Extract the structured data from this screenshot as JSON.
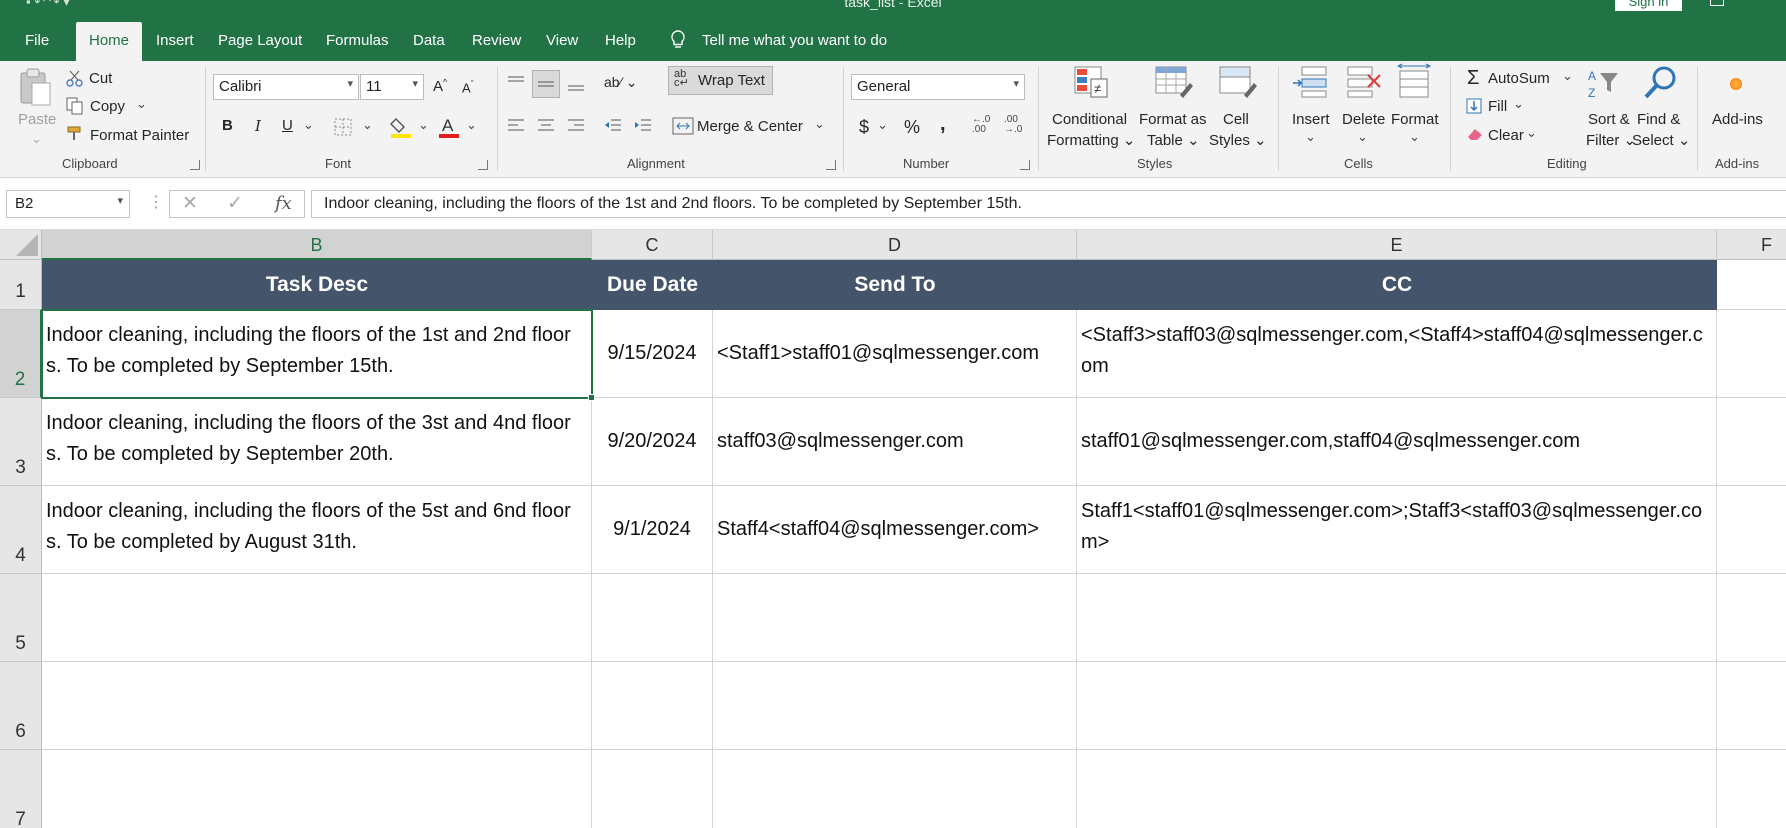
{
  "window": {
    "title": "task_list  -  Excel",
    "signin": "Sign in"
  },
  "tabs": [
    {
      "label": "File"
    },
    {
      "label": "Home"
    },
    {
      "label": "Insert"
    },
    {
      "label": "Page Layout"
    },
    {
      "label": "Formulas"
    },
    {
      "label": "Data"
    },
    {
      "label": "Review"
    },
    {
      "label": "View"
    },
    {
      "label": "Help"
    }
  ],
  "tell_me": "Tell me what you want to do",
  "ribbon": {
    "clipboard": {
      "paste": "Paste",
      "cut": "Cut",
      "copy": "Copy",
      "format_painter": "Format Painter",
      "group": "Clipboard"
    },
    "font": {
      "name": "Calibri",
      "size": "11",
      "group": "Font",
      "bold": "B",
      "italic": "I",
      "underline": "U"
    },
    "alignment": {
      "wrap_text": "Wrap Text",
      "merge_center": "Merge & Center",
      "group": "Alignment"
    },
    "number": {
      "format": "General",
      "currency": "$",
      "percent": "%",
      "comma": ",",
      "inc_decimal": "←.0 .00",
      "group": "Number"
    },
    "styles": {
      "conditional": "Conditional",
      "formatting": "Formatting",
      "format_as": "Format as",
      "table": "Table",
      "cell": "Cell",
      "cell_styles": "Styles",
      "group": "Styles"
    },
    "cells": {
      "insert": "Insert",
      "delete": "Delete",
      "format": "Format",
      "group": "Cells"
    },
    "editing": {
      "autosum": "AutoSum",
      "fill": "Fill",
      "clear": "Clear",
      "sort": "Sort &",
      "filter": "Filter",
      "find": "Find &",
      "select": "Select",
      "group": "Editing"
    },
    "addins": {
      "label": "Add-ins",
      "group": "Add-ins"
    }
  },
  "formula_bar": {
    "name_box": "B2",
    "fx": "fx",
    "content": "Indoor cleaning, including the floors of the 1st and 2nd floors. To be completed by September 15th."
  },
  "columns": [
    "B",
    "C",
    "D",
    "E",
    "F"
  ],
  "rows": [
    "1",
    "2",
    "3",
    "4",
    "5",
    "6",
    "7"
  ],
  "table": {
    "headers": [
      "Task Desc",
      "Due Date",
      "Send To",
      "CC"
    ],
    "data": [
      [
        "Indoor cleaning, including the floors of the 1st and 2nd floors. To be completed by September 15th.",
        "9/15/2024",
        "<Staff1>staff01@sqlmessenger.com",
        "<Staff3>staff03@sqlmessenger.com,<Staff4>staff04@sqlmessenger.com"
      ],
      [
        "Indoor cleaning, including the floors of the 3st and 4nd floors. To be completed by September 20th.",
        "9/20/2024",
        "staff03@sqlmessenger.com",
        "staff01@sqlmessenger.com,staff04@sqlmessenger.com"
      ],
      [
        "Indoor cleaning, including the floors of the 5st and 6nd floors. To be completed by August 31th.",
        "9/1/2024",
        "Staff4<staff04@sqlmessenger.com>",
        "Staff1<staff01@sqlmessenger.com>;Staff3<staff03@sqlmessenger.com>"
      ]
    ]
  },
  "colors": {
    "excel_green": "#217346",
    "header_fill": "#44546a"
  }
}
